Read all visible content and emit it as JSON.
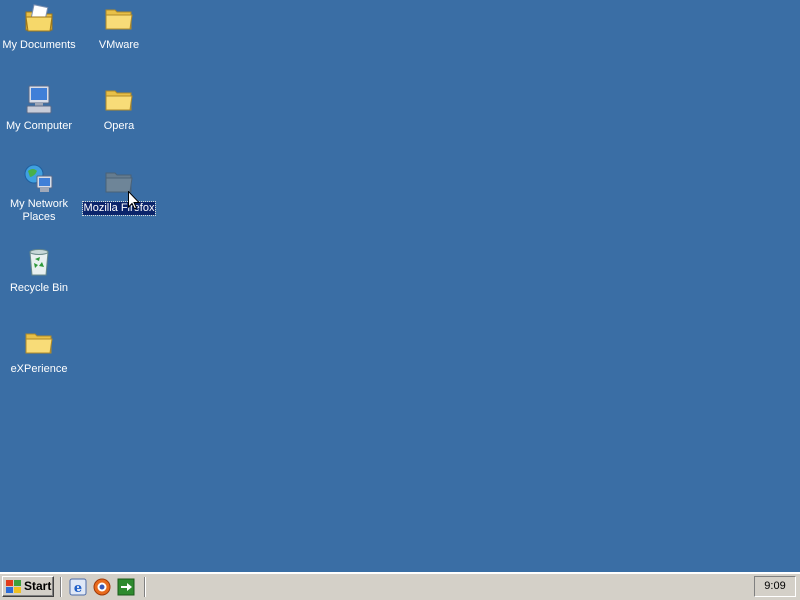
{
  "desktop": {
    "background_color": "#3a6ea5",
    "icons": [
      {
        "label": "My Documents",
        "icon": "my-documents-icon"
      },
      {
        "label": "VMware",
        "icon": "folder-icon"
      },
      {
        "label": "My Computer",
        "icon": "my-computer-icon"
      },
      {
        "label": "Opera",
        "icon": "folder-icon"
      },
      {
        "label": "My Network Places",
        "icon": "network-places-icon"
      },
      {
        "label": "Mozilla Firefox",
        "icon": "folder-icon",
        "selected": true
      },
      {
        "label": "Recycle Bin",
        "icon": "recycle-bin-icon"
      },
      {
        "label": "eXPerience",
        "icon": "folder-icon"
      }
    ]
  },
  "taskbar": {
    "start_label": "Start",
    "quick_launch": [
      {
        "icon": "internet-explorer-icon"
      },
      {
        "icon": "firefox-icon"
      },
      {
        "icon": "show-desktop-icon"
      }
    ],
    "clock": "9:09"
  }
}
